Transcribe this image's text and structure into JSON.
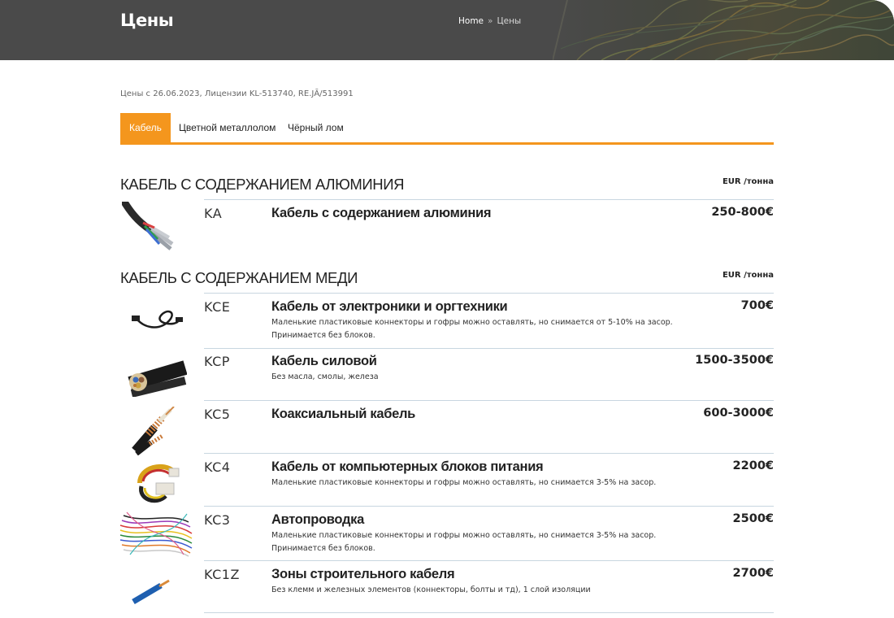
{
  "header": {
    "title": "Цены",
    "breadcrumb": {
      "home": "Home",
      "separator": "»",
      "current": "Цены"
    }
  },
  "note": "Цены с 26.06.2023, Лицензии KL-513740, RE.JĀ/513991",
  "tabs": [
    {
      "label": "Кабель",
      "active": true
    },
    {
      "label": "Цветной металлолом",
      "active": false
    },
    {
      "label": "Чёрный лом",
      "active": false
    }
  ],
  "colors": {
    "accent": "#f4961d",
    "header_bg": "#4a4a4a",
    "rule": "#c8d6e0"
  },
  "sections": [
    {
      "title": "КАБЕЛЬ С СОДЕРЖАНИЕМ АЛЮМИНИЯ",
      "unit_currency": "EUR",
      "unit_per": "/тонна",
      "items": [
        {
          "code": "KA",
          "name": "Кабель с содержанием алюминия",
          "desc": "",
          "price": "250-800€",
          "icon": "aluminium-cable-image"
        }
      ]
    },
    {
      "title": "КАБЕЛЬ С СОДЕРЖАНИЕМ МЕДИ",
      "unit_currency": "EUR",
      "unit_per": "/тонна",
      "items": [
        {
          "code": "KCE",
          "name": "Кабель от электроники и оргтехники",
          "desc": "Маленькие пластиковые коннекторы и гофры можно оставлять, но снимается от 5-10% на засор. Принимается без блоков.",
          "price": "700€",
          "icon": "usb-cable-image"
        },
        {
          "code": "KCP",
          "name": "Кабель силовой",
          "desc": "Без масла, смолы, железа",
          "price": "1500-3500€",
          "icon": "power-cable-image"
        },
        {
          "code": "KC5",
          "name": "Коаксиальный кабель",
          "desc": "",
          "price": "600-3000€",
          "icon": "coaxial-cable-image"
        },
        {
          "code": "KC4",
          "name": "Кабель от компьютерных блоков питания",
          "desc": "Маленькие пластиковые коннекторы и гофры можно оставлять, но снимается 3-5% на засор.",
          "price": "2200€",
          "icon": "psu-cable-image"
        },
        {
          "code": "KC3",
          "name": "Автопроводка",
          "desc": "Маленькие пластиковые коннекторы и гофры можно оставлять, но снимается 3-5% на засор. Принимается без блоков.",
          "price": "2500€",
          "icon": "car-wiring-image"
        },
        {
          "code": "KC1Z",
          "name": "Зоны строительного кабеля",
          "desc": "Без клемм и железных элементов (коннекторы, болты и тд), 1 слой изоляции",
          "price": "2700€",
          "icon": "building-cable-image"
        }
      ]
    }
  ]
}
